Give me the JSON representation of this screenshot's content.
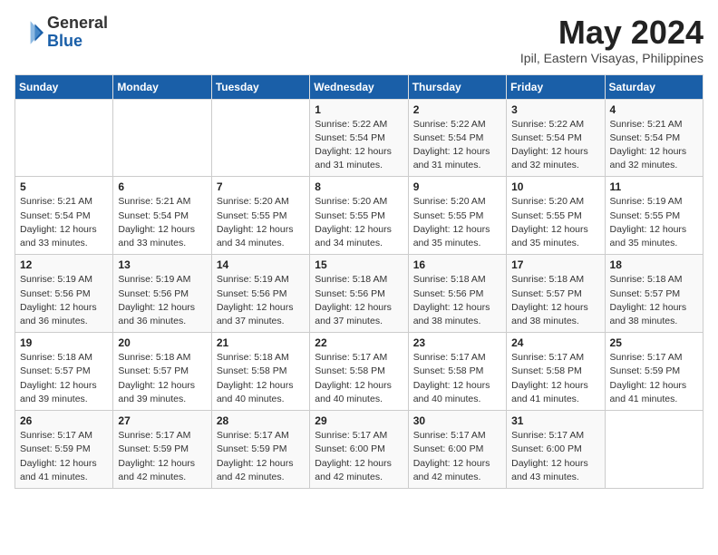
{
  "header": {
    "logo_general": "General",
    "logo_blue": "Blue",
    "month_title": "May 2024",
    "location": "Ipil, Eastern Visayas, Philippines"
  },
  "weekdays": [
    "Sunday",
    "Monday",
    "Tuesday",
    "Wednesday",
    "Thursday",
    "Friday",
    "Saturday"
  ],
  "weeks": [
    [
      {
        "day": "",
        "info": ""
      },
      {
        "day": "",
        "info": ""
      },
      {
        "day": "",
        "info": ""
      },
      {
        "day": "1",
        "info": "Sunrise: 5:22 AM\nSunset: 5:54 PM\nDaylight: 12 hours\nand 31 minutes."
      },
      {
        "day": "2",
        "info": "Sunrise: 5:22 AM\nSunset: 5:54 PM\nDaylight: 12 hours\nand 31 minutes."
      },
      {
        "day": "3",
        "info": "Sunrise: 5:22 AM\nSunset: 5:54 PM\nDaylight: 12 hours\nand 32 minutes."
      },
      {
        "day": "4",
        "info": "Sunrise: 5:21 AM\nSunset: 5:54 PM\nDaylight: 12 hours\nand 32 minutes."
      }
    ],
    [
      {
        "day": "5",
        "info": "Sunrise: 5:21 AM\nSunset: 5:54 PM\nDaylight: 12 hours\nand 33 minutes."
      },
      {
        "day": "6",
        "info": "Sunrise: 5:21 AM\nSunset: 5:54 PM\nDaylight: 12 hours\nand 33 minutes."
      },
      {
        "day": "7",
        "info": "Sunrise: 5:20 AM\nSunset: 5:55 PM\nDaylight: 12 hours\nand 34 minutes."
      },
      {
        "day": "8",
        "info": "Sunrise: 5:20 AM\nSunset: 5:55 PM\nDaylight: 12 hours\nand 34 minutes."
      },
      {
        "day": "9",
        "info": "Sunrise: 5:20 AM\nSunset: 5:55 PM\nDaylight: 12 hours\nand 35 minutes."
      },
      {
        "day": "10",
        "info": "Sunrise: 5:20 AM\nSunset: 5:55 PM\nDaylight: 12 hours\nand 35 minutes."
      },
      {
        "day": "11",
        "info": "Sunrise: 5:19 AM\nSunset: 5:55 PM\nDaylight: 12 hours\nand 35 minutes."
      }
    ],
    [
      {
        "day": "12",
        "info": "Sunrise: 5:19 AM\nSunset: 5:56 PM\nDaylight: 12 hours\nand 36 minutes."
      },
      {
        "day": "13",
        "info": "Sunrise: 5:19 AM\nSunset: 5:56 PM\nDaylight: 12 hours\nand 36 minutes."
      },
      {
        "day": "14",
        "info": "Sunrise: 5:19 AM\nSunset: 5:56 PM\nDaylight: 12 hours\nand 37 minutes."
      },
      {
        "day": "15",
        "info": "Sunrise: 5:18 AM\nSunset: 5:56 PM\nDaylight: 12 hours\nand 37 minutes."
      },
      {
        "day": "16",
        "info": "Sunrise: 5:18 AM\nSunset: 5:56 PM\nDaylight: 12 hours\nand 38 minutes."
      },
      {
        "day": "17",
        "info": "Sunrise: 5:18 AM\nSunset: 5:57 PM\nDaylight: 12 hours\nand 38 minutes."
      },
      {
        "day": "18",
        "info": "Sunrise: 5:18 AM\nSunset: 5:57 PM\nDaylight: 12 hours\nand 38 minutes."
      }
    ],
    [
      {
        "day": "19",
        "info": "Sunrise: 5:18 AM\nSunset: 5:57 PM\nDaylight: 12 hours\nand 39 minutes."
      },
      {
        "day": "20",
        "info": "Sunrise: 5:18 AM\nSunset: 5:57 PM\nDaylight: 12 hours\nand 39 minutes."
      },
      {
        "day": "21",
        "info": "Sunrise: 5:18 AM\nSunset: 5:58 PM\nDaylight: 12 hours\nand 40 minutes."
      },
      {
        "day": "22",
        "info": "Sunrise: 5:17 AM\nSunset: 5:58 PM\nDaylight: 12 hours\nand 40 minutes."
      },
      {
        "day": "23",
        "info": "Sunrise: 5:17 AM\nSunset: 5:58 PM\nDaylight: 12 hours\nand 40 minutes."
      },
      {
        "day": "24",
        "info": "Sunrise: 5:17 AM\nSunset: 5:58 PM\nDaylight: 12 hours\nand 41 minutes."
      },
      {
        "day": "25",
        "info": "Sunrise: 5:17 AM\nSunset: 5:59 PM\nDaylight: 12 hours\nand 41 minutes."
      }
    ],
    [
      {
        "day": "26",
        "info": "Sunrise: 5:17 AM\nSunset: 5:59 PM\nDaylight: 12 hours\nand 41 minutes."
      },
      {
        "day": "27",
        "info": "Sunrise: 5:17 AM\nSunset: 5:59 PM\nDaylight: 12 hours\nand 42 minutes."
      },
      {
        "day": "28",
        "info": "Sunrise: 5:17 AM\nSunset: 5:59 PM\nDaylight: 12 hours\nand 42 minutes."
      },
      {
        "day": "29",
        "info": "Sunrise: 5:17 AM\nSunset: 6:00 PM\nDaylight: 12 hours\nand 42 minutes."
      },
      {
        "day": "30",
        "info": "Sunrise: 5:17 AM\nSunset: 6:00 PM\nDaylight: 12 hours\nand 42 minutes."
      },
      {
        "day": "31",
        "info": "Sunrise: 5:17 AM\nSunset: 6:00 PM\nDaylight: 12 hours\nand 43 minutes."
      },
      {
        "day": "",
        "info": ""
      }
    ]
  ]
}
